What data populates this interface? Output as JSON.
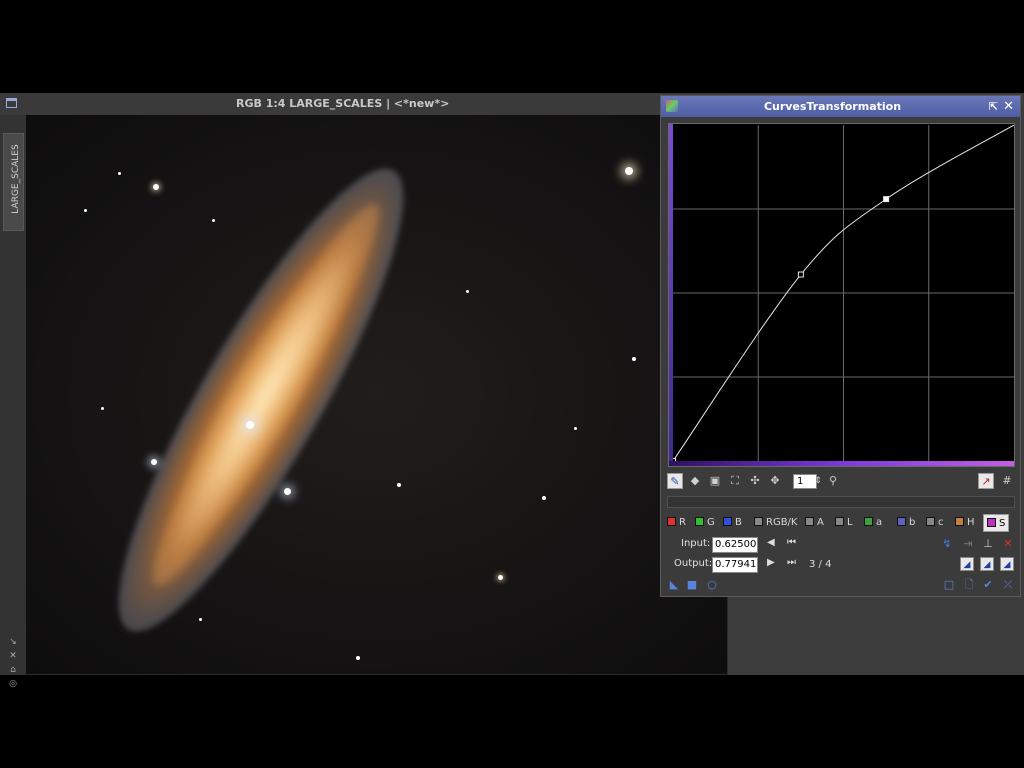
{
  "image_window": {
    "title": "RGB 1:4 LARGE_SCALES | <*new*>",
    "side_tab_label": "LARGE_SCALES",
    "side_tools": [
      "↘",
      "✕",
      "⌂",
      "◎"
    ]
  },
  "curves": {
    "title": "CurvesTransformation",
    "pin_icon": "⇱",
    "close_icon": "✕",
    "toolbar": {
      "zoom_value": "1",
      "zoom_spin_icon": "⇕",
      "icons": [
        "edit-point-icon",
        "select-point-icon",
        "delete-point-icon",
        "zoom-fit-icon",
        "zoom-in-icon",
        "pan-icon",
        "zoom-icon",
        "curve-color-icon",
        "grid-icon"
      ]
    },
    "channels": [
      {
        "label": "R",
        "color": "#e03030"
      },
      {
        "label": "G",
        "color": "#30c030"
      },
      {
        "label": "B",
        "color": "#3050e0"
      },
      {
        "label": "RGB/K",
        "color": "#888888"
      },
      {
        "label": "A",
        "color": "#888888"
      },
      {
        "label": "L",
        "color": "#888888"
      },
      {
        "label": "a",
        "color": "#40a040"
      },
      {
        "label": "b",
        "color": "#6060c0"
      },
      {
        "label": "c",
        "color": "#888888"
      },
      {
        "label": "H",
        "color": "#c08040"
      },
      {
        "label": "S",
        "color": "#c030c0"
      }
    ],
    "selected_channel": "S",
    "input_label": "Input:",
    "input_value": "0.62500",
    "output_label": "Output:",
    "output_value": "0.77941",
    "point_position": "3 / 4",
    "curve_points": [
      [
        0,
        0
      ],
      [
        0.375,
        0.555
      ],
      [
        0.625,
        0.77941
      ],
      [
        1,
        1
      ]
    ],
    "grid_divisions": 4
  }
}
